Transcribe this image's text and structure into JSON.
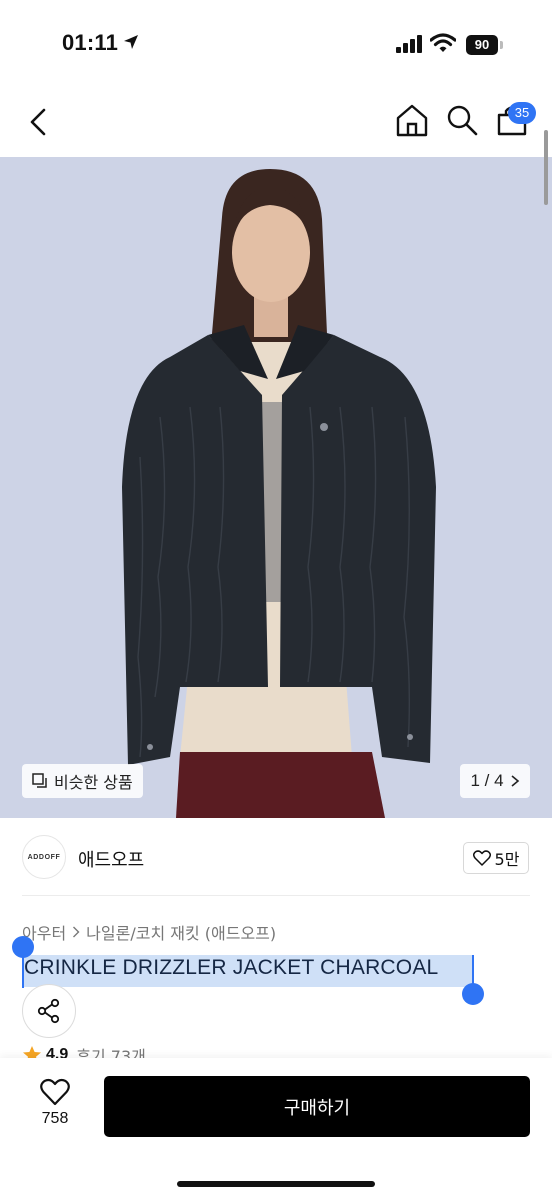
{
  "status_bar": {
    "time": "01:11",
    "battery": "90"
  },
  "header": {
    "cart_count": "35"
  },
  "gallery": {
    "similar_label": "비슷한 상품",
    "pager": "1 / 4"
  },
  "brand": {
    "logo_text": "ADDOFF",
    "name": "애드오프",
    "like_count": "5만"
  },
  "product": {
    "breadcrumb": [
      "아우터",
      "나일론/코치 재킷 (애드오프)"
    ],
    "title": "CRINKLE DRIZZLER JACKET CHARCOAL",
    "rating": "4.9",
    "reviews": "후기 73개"
  },
  "bottom": {
    "wish_count": "758",
    "buy_label": "구매하기"
  },
  "colors": {
    "accent": "#2f74f4",
    "buy_button": "#000000",
    "hero_bg": "#cdd3e6",
    "selection": "#cfe0f7"
  }
}
